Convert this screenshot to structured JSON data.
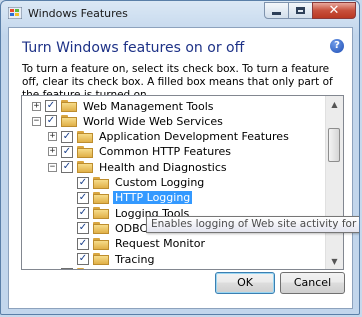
{
  "window": {
    "title": "Windows Features",
    "heading": "Turn Windows features on or off",
    "description": "To turn a feature on, select its check box. To turn a feature off, clear its check box. A filled box means that only part of the feature is turned on."
  },
  "tree": {
    "rows": [
      {
        "label": "Web Management Tools",
        "level": 0,
        "expander": "+",
        "checked": true
      },
      {
        "label": "World Wide Web Services",
        "level": 0,
        "expander": "−",
        "checked": true
      },
      {
        "label": "Application Development Features",
        "level": 1,
        "expander": "+",
        "checked": true
      },
      {
        "label": "Common HTTP Features",
        "level": 1,
        "expander": "+",
        "checked": true
      },
      {
        "label": "Health and Diagnostics",
        "level": 1,
        "expander": "−",
        "checked": true
      },
      {
        "label": "Custom Logging",
        "level": 2,
        "expander": "",
        "checked": true
      },
      {
        "label": "HTTP Logging",
        "level": 2,
        "expander": "",
        "checked": true,
        "selected": true
      },
      {
        "label": "Logging Tools",
        "level": 2,
        "expander": "",
        "checked": true
      },
      {
        "label": "ODBC",
        "level": 2,
        "expander": "",
        "checked": true
      },
      {
        "label": "Request Monitor",
        "level": 2,
        "expander": "",
        "checked": true
      },
      {
        "label": "Tracing",
        "level": 2,
        "expander": "",
        "checked": true
      },
      {
        "label": "Performance Features",
        "level": 1,
        "expander": "+",
        "checked": true
      }
    ]
  },
  "tooltip": "Enables logging of Web site activity for this serve",
  "buttons": {
    "ok": "OK",
    "cancel": "Cancel"
  },
  "colors": {
    "heading": "#1e3287",
    "selection": "#3399ff"
  }
}
